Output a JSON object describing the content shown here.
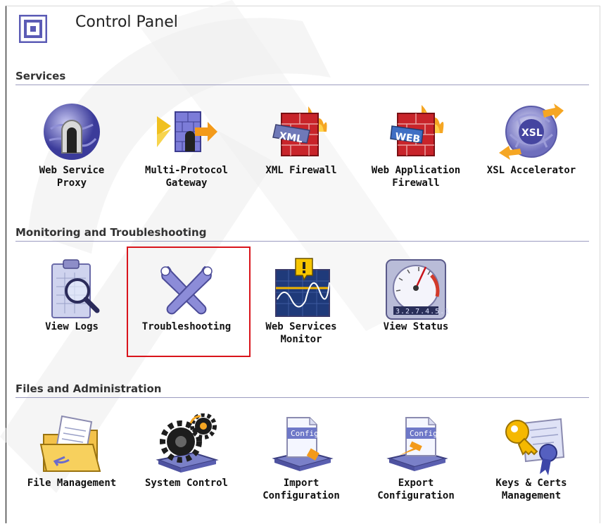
{
  "header": {
    "title": "Control Panel",
    "logo": "control-panel-logo"
  },
  "sections": {
    "services": {
      "title": "Services",
      "items": [
        {
          "label": "Web Service\nProxy",
          "icon": "globe-arch-icon"
        },
        {
          "label": "Multi-Protocol\nGateway",
          "icon": "gateway-arrow-icon"
        },
        {
          "label": "XML Firewall",
          "icon": "xml-firewall-icon"
        },
        {
          "label": "Web Application\nFirewall",
          "icon": "web-firewall-icon"
        },
        {
          "label": "XSL Accelerator",
          "icon": "xsl-accelerator-icon"
        }
      ]
    },
    "monitoring": {
      "title": "Monitoring and Troubleshooting",
      "items": [
        {
          "label": "View Logs",
          "icon": "clipboard-magnifier-icon"
        },
        {
          "label": "Troubleshooting",
          "icon": "crossed-wrenches-icon"
        },
        {
          "label": "Web Services\nMonitor",
          "icon": "monitor-alert-icon"
        },
        {
          "label": "View Status",
          "icon": "gauge-icon",
          "counter": "327451"
        }
      ]
    },
    "files": {
      "title": "Files and Administration",
      "items": [
        {
          "label": "File Management",
          "icon": "folder-document-icon"
        },
        {
          "label": "System Control",
          "icon": "gears-icon"
        },
        {
          "label": "Import\nConfiguration",
          "icon": "config-import-icon",
          "badge": "Config"
        },
        {
          "label": "Export\nConfiguration",
          "icon": "config-export-icon",
          "badge": "Config"
        },
        {
          "label": "Keys & Certs\nManagement",
          "icon": "key-certificate-icon"
        }
      ]
    }
  },
  "colors": {
    "rule": "#9c9cc0",
    "highlight": "#d9141b",
    "accent": "#6a6ad0"
  }
}
